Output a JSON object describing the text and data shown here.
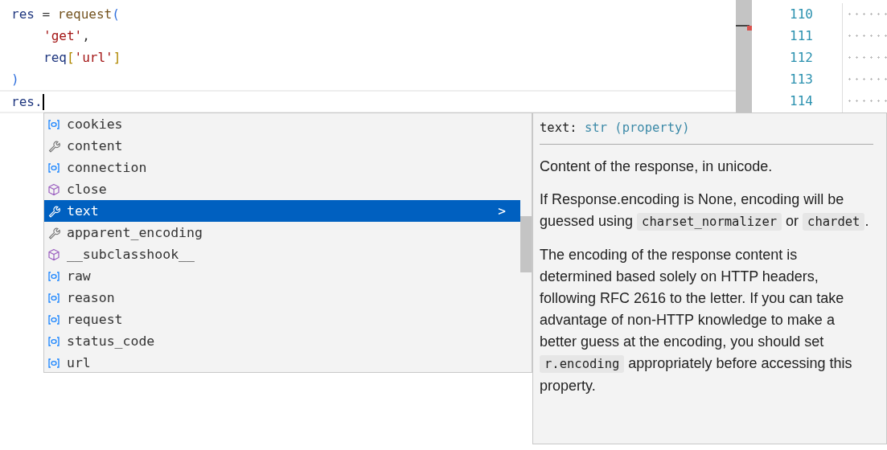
{
  "editor": {
    "lines": [
      {
        "indented": false,
        "current": false,
        "tokens": [
          {
            "text": "res",
            "kind": "variable"
          },
          {
            "text": " = ",
            "kind": "operator"
          },
          {
            "text": "request",
            "kind": "function"
          },
          {
            "text": "(",
            "kind": "paren"
          }
        ]
      },
      {
        "indented": true,
        "current": false,
        "tokens": [
          {
            "text": "'get'",
            "kind": "string"
          },
          {
            "text": ",",
            "kind": "operator"
          }
        ]
      },
      {
        "indented": true,
        "current": false,
        "tokens": [
          {
            "text": "req",
            "kind": "variable"
          },
          {
            "text": "[",
            "kind": "bracket"
          },
          {
            "text": "'url'",
            "kind": "string"
          },
          {
            "text": "]",
            "kind": "bracket"
          }
        ]
      },
      {
        "indented": false,
        "current": false,
        "tokens": [
          {
            "text": ")",
            "kind": "paren"
          }
        ]
      },
      {
        "indented": false,
        "current": true,
        "tokens": [
          {
            "text": "res.",
            "kind": "variable"
          }
        ]
      }
    ],
    "line_numbers": [
      "110",
      "111",
      "112",
      "113",
      "114"
    ]
  },
  "suggestions": [
    {
      "label": "cookies",
      "kind": "field",
      "selected": false
    },
    {
      "label": "content",
      "kind": "property",
      "selected": false
    },
    {
      "label": "connection",
      "kind": "field",
      "selected": false
    },
    {
      "label": "close",
      "kind": "method",
      "selected": false
    },
    {
      "label": "text",
      "kind": "property",
      "selected": true
    },
    {
      "label": "apparent_encoding",
      "kind": "property",
      "selected": false
    },
    {
      "label": "__subclasshook__",
      "kind": "method",
      "selected": false
    },
    {
      "label": "raw",
      "kind": "field",
      "selected": false
    },
    {
      "label": "reason",
      "kind": "field",
      "selected": false
    },
    {
      "label": "request",
      "kind": "field",
      "selected": false
    },
    {
      "label": "status_code",
      "kind": "field",
      "selected": false
    },
    {
      "label": "url",
      "kind": "field",
      "selected": false
    }
  ],
  "details": {
    "expand_glyph": ">",
    "signature": {
      "name": "text:",
      "type": "str",
      "qualifier": "(property)"
    },
    "paragraphs": [
      [
        {
          "text": "Content of the response, in unicode.",
          "kind": "text"
        }
      ],
      [
        {
          "text": "If Response.encoding is None, encoding will be guessed using ",
          "kind": "text"
        },
        {
          "text": "charset_normalizer",
          "kind": "code"
        },
        {
          "text": " or ",
          "kind": "text"
        },
        {
          "text": "chardet",
          "kind": "code"
        },
        {
          "text": ".",
          "kind": "text"
        }
      ],
      [
        {
          "text": "The encoding of the response content is determined based solely on HTTP headers, following RFC 2616 to the letter. If you can take advantage of non-HTTP knowledge to make a better guess at the encoding, you should set ",
          "kind": "text"
        },
        {
          "text": "r.encoding",
          "kind": "code"
        },
        {
          "text": " appropriately before accessing this property.",
          "kind": "text"
        }
      ]
    ]
  }
}
